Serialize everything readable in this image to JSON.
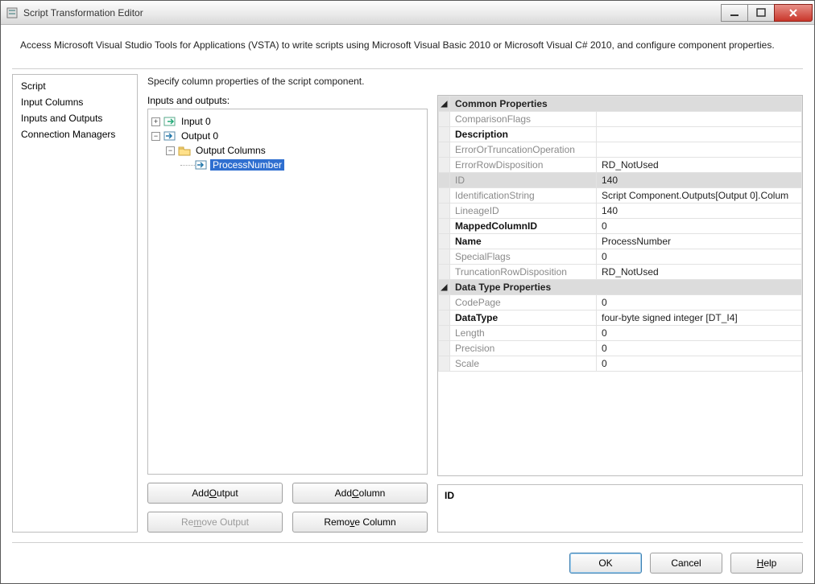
{
  "window": {
    "title": "Script Transformation Editor"
  },
  "description": "Access Microsoft Visual Studio Tools for Applications (VSTA) to write scripts using Microsoft Visual Basic 2010 or Microsoft Visual C# 2010, and configure component properties.",
  "sidebar": {
    "items": [
      {
        "label": "Script"
      },
      {
        "label": "Input Columns"
      },
      {
        "label": "Inputs and Outputs"
      },
      {
        "label": "Connection Managers"
      }
    ]
  },
  "page": {
    "header": "Specify column properties of the script component.",
    "treeLabel": "Inputs and outputs:",
    "tree": {
      "input0": "Input 0",
      "output0": "Output 0",
      "outputColumns": "Output Columns",
      "processNumber": "ProcessNumber"
    },
    "buttons": {
      "addOutput_pre": "Add ",
      "addOutput_u": "O",
      "addOutput_post": "utput",
      "addColumn_pre": "Add ",
      "addColumn_u": "C",
      "addColumn_post": "olumn",
      "removeOutput_pre": "Re",
      "removeOutput_u": "m",
      "removeOutput_post": "ove Output",
      "removeColumn_pre": "Remo",
      "removeColumn_u": "v",
      "removeColumn_post": "e Column"
    }
  },
  "propgrid": {
    "cat1": "Common Properties",
    "cat2": "Data Type Properties",
    "rows1": [
      {
        "name": "ComparisonFlags",
        "value": "",
        "dim": true
      },
      {
        "name": "Description",
        "value": "",
        "bold": true
      },
      {
        "name": "ErrorOrTruncationOperation",
        "value": "",
        "dim": true
      },
      {
        "name": "ErrorRowDisposition",
        "value": "RD_NotUsed",
        "dim": true
      },
      {
        "name": "ID",
        "value": "140",
        "dim": true,
        "selected": true
      },
      {
        "name": "IdentificationString",
        "value": "Script Component.Outputs[Output 0].Colum",
        "dim": true
      },
      {
        "name": "LineageID",
        "value": "140",
        "dim": true
      },
      {
        "name": "MappedColumnID",
        "value": "0",
        "bold": true
      },
      {
        "name": "Name",
        "value": "ProcessNumber",
        "bold": true
      },
      {
        "name": "SpecialFlags",
        "value": "0",
        "dim": true
      },
      {
        "name": "TruncationRowDisposition",
        "value": "RD_NotUsed",
        "dim": true
      }
    ],
    "rows2": [
      {
        "name": "CodePage",
        "value": "0",
        "dim": true
      },
      {
        "name": "DataType",
        "value": "four-byte signed integer [DT_I4]",
        "bold": true
      },
      {
        "name": "Length",
        "value": "0",
        "dim": true
      },
      {
        "name": "Precision",
        "value": "0",
        "dim": true
      },
      {
        "name": "Scale",
        "value": "0",
        "dim": true
      }
    ],
    "descTitle": "ID"
  },
  "footer": {
    "ok": "OK",
    "cancel": "Cancel",
    "help_u": "H",
    "help_post": "elp"
  }
}
